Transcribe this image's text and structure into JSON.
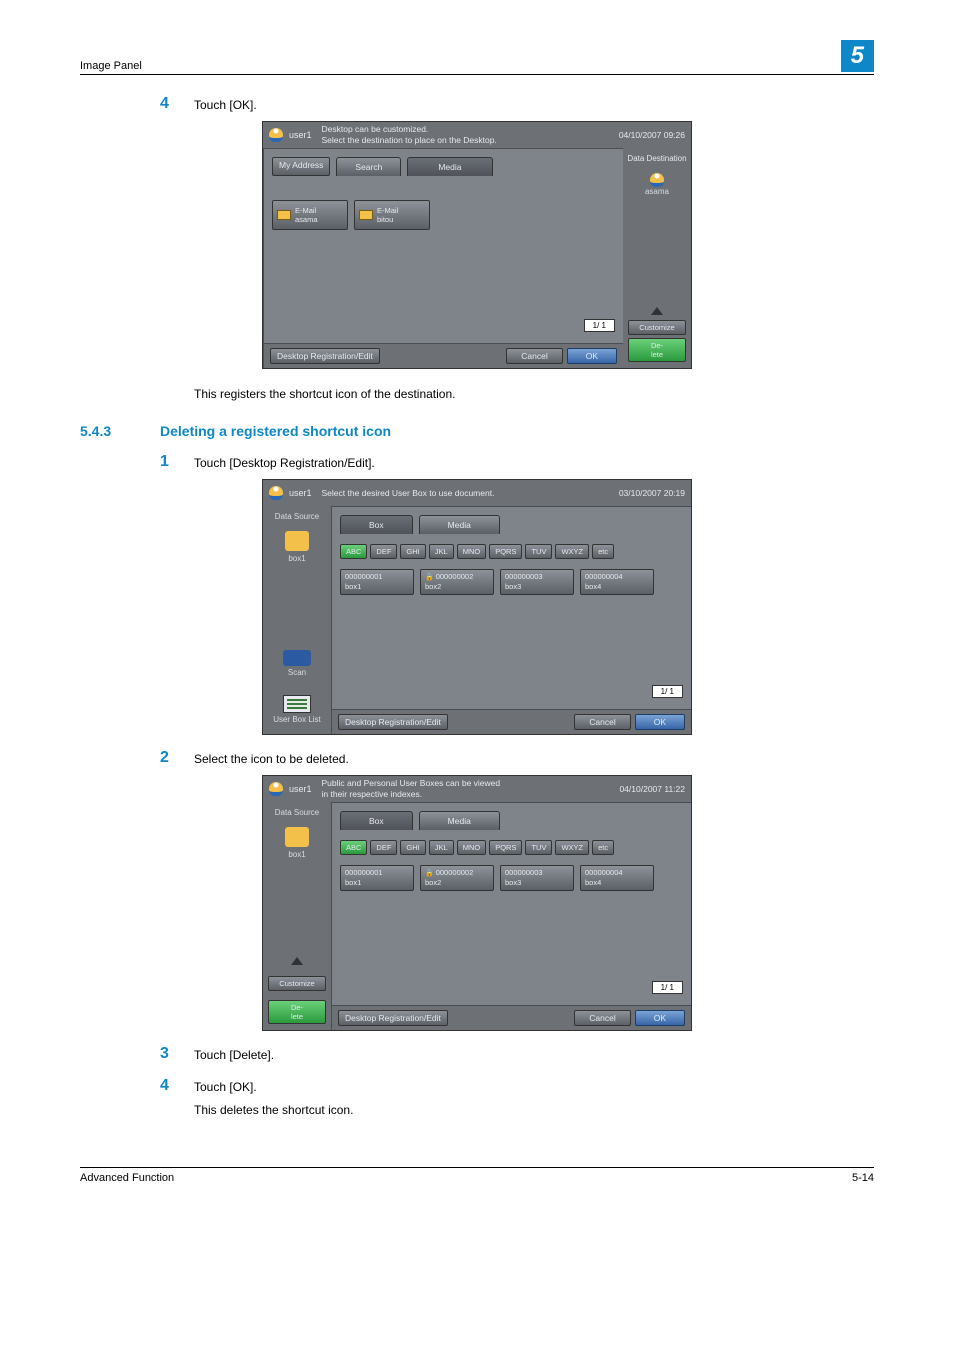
{
  "header": {
    "label": "Image Panel",
    "chapter": "5"
  },
  "pre_step": {
    "num": "4",
    "text": "Touch [OK]."
  },
  "shot1": {
    "user": "user1",
    "msg_l1": "Desktop can be customized.",
    "msg_l2": "Select the destination to place on the Desktop.",
    "date": "04/10/2007 09:26",
    "side_btn": "My Address",
    "tab_search": "Search",
    "tab_media": "Media",
    "email1_l1": "E-Mail",
    "email1_l2": "asama",
    "email2_l1": "E-Mail",
    "email2_l2": "bitou",
    "pager": "1/  1",
    "right_title": "Data Destination",
    "right_name": "asama",
    "customize": "Customize",
    "delete": "De-\nlete",
    "footer_btn": "Desktop Registration/Edit",
    "cancel": "Cancel",
    "ok": "OK"
  },
  "after_shot1": "This registers the shortcut icon of the destination.",
  "section": {
    "num": "5.4.3",
    "title": "Deleting a registered shortcut icon"
  },
  "step1": {
    "num": "1",
    "text": "Touch [Desktop Registration/Edit]."
  },
  "shot2": {
    "user": "user1",
    "msg": "Select the desired User Box to use document.",
    "date": "03/10/2007 20:19",
    "side_label": "Data Source",
    "side_box": "box1",
    "scan": "Scan",
    "user_box_list": "User Box List",
    "tab_box": "Box",
    "tab_media": "Media",
    "letters": [
      "ABC",
      "DEF",
      "GHI",
      "JKL",
      "MNO",
      "PQRS",
      "TUV",
      "WXYZ",
      "etc"
    ],
    "boxes": [
      {
        "id": "000000001",
        "name": "box1",
        "locked": false
      },
      {
        "id": "000000002",
        "name": "box2",
        "locked": true
      },
      {
        "id": "000000003",
        "name": "box3",
        "locked": false
      },
      {
        "id": "000000004",
        "name": "box4",
        "locked": false
      }
    ],
    "pager": "1/  1",
    "footer_btn": "Desktop Registration/Edit",
    "cancel": "Cancel",
    "ok": "OK"
  },
  "step2": {
    "num": "2",
    "text": "Select the icon to be deleted."
  },
  "shot3": {
    "user": "user1",
    "msg_l1": "Public and Personal User Boxes can be viewed",
    "msg_l2": "in their respective indexes.",
    "date": "04/10/2007 11:22",
    "side_label": "Data Source",
    "side_box": "box1",
    "customize": "Customize",
    "delete": "De-\nlete",
    "tab_box": "Box",
    "tab_media": "Media",
    "letters": [
      "ABC",
      "DEF",
      "GHI",
      "JKL",
      "MNO",
      "PQRS",
      "TUV",
      "WXYZ",
      "etc"
    ],
    "boxes": [
      {
        "id": "000000001",
        "name": "box1",
        "locked": false
      },
      {
        "id": "000000002",
        "name": "box2",
        "locked": true
      },
      {
        "id": "000000003",
        "name": "box3",
        "locked": false
      },
      {
        "id": "000000004",
        "name": "box4",
        "locked": false
      }
    ],
    "pager": "1/  1",
    "footer_btn": "Desktop Registration/Edit",
    "cancel": "Cancel",
    "ok": "OK"
  },
  "step3": {
    "num": "3",
    "text": "Touch [Delete]."
  },
  "step4": {
    "num": "4",
    "text": "Touch [OK]."
  },
  "closing": "This deletes the shortcut icon.",
  "footer": {
    "left": "Advanced Function",
    "right": "5-14"
  }
}
